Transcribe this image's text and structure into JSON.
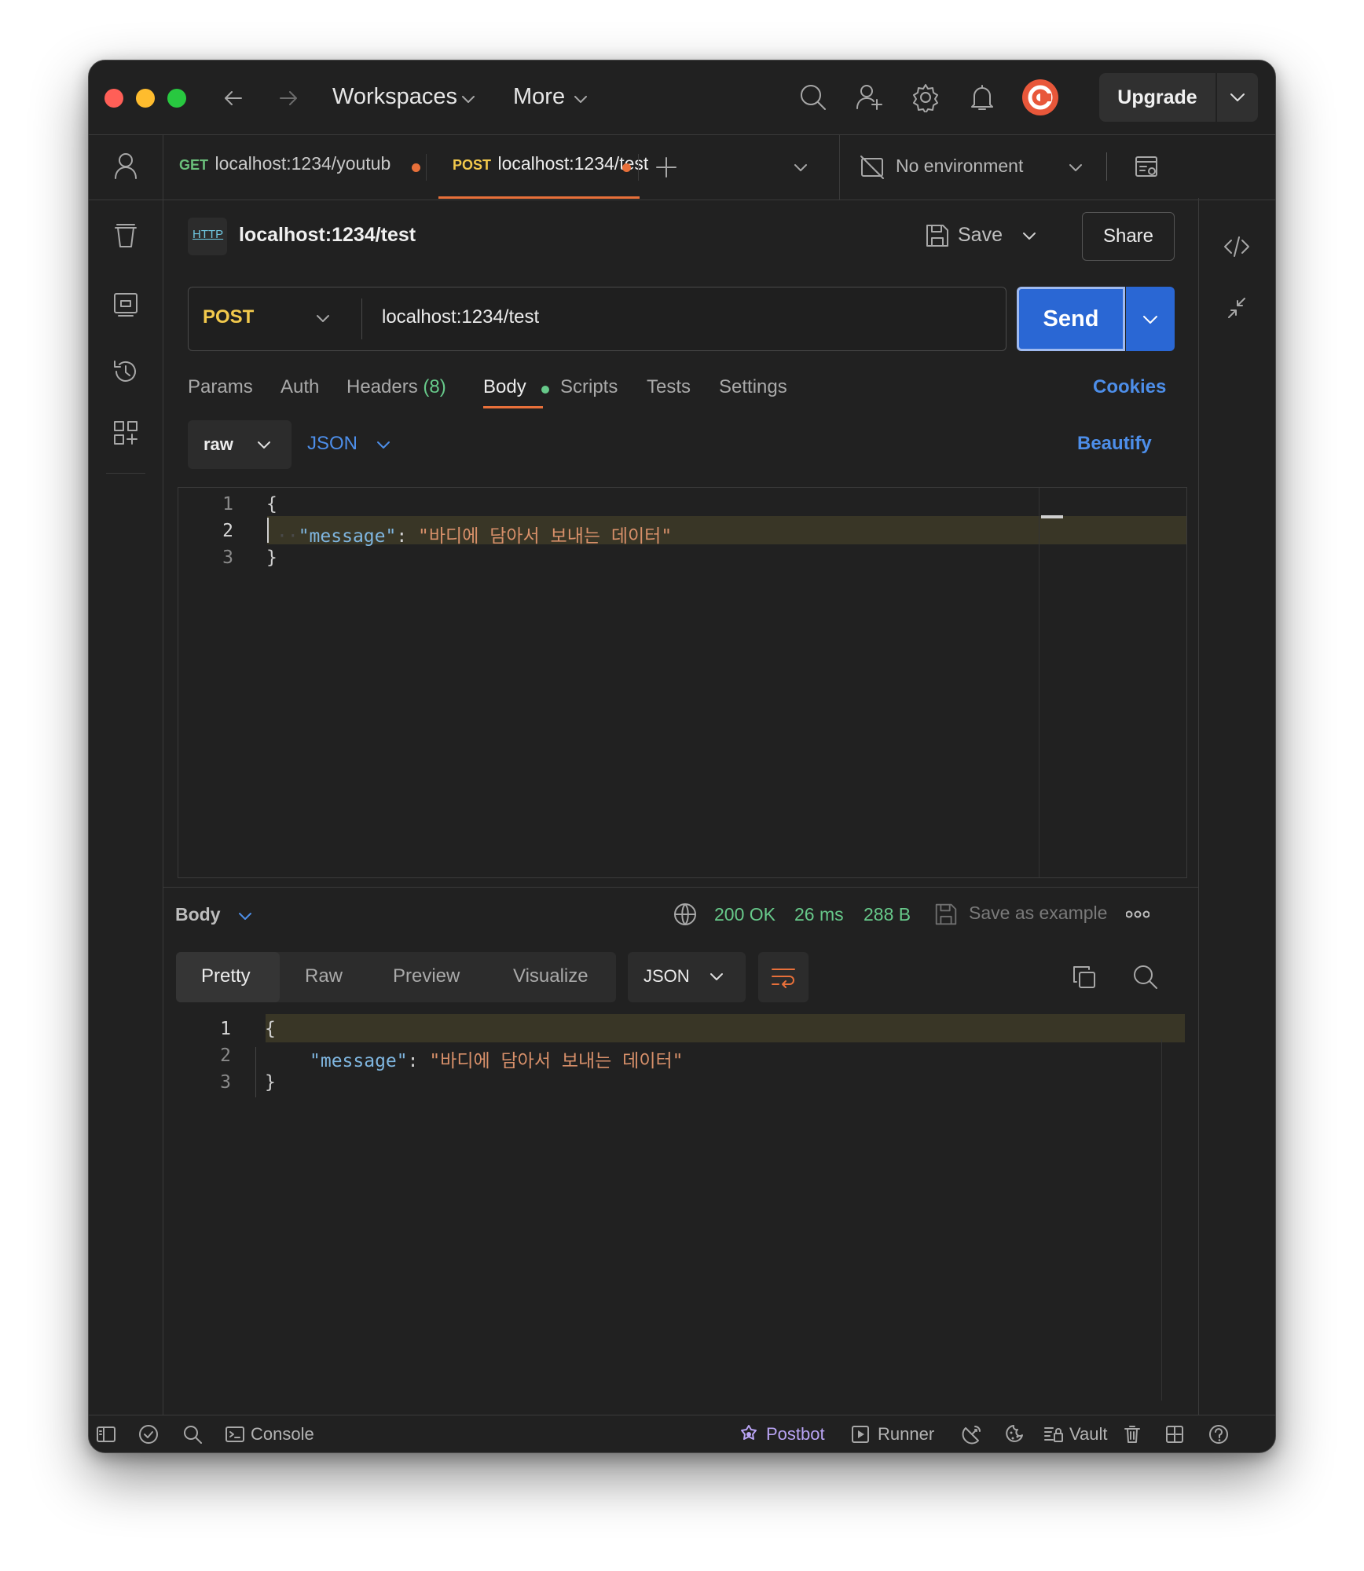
{
  "window": {
    "nav": {
      "workspaces_label": "Workspaces",
      "more_label": "More",
      "upgrade_label": "Upgrade"
    },
    "traffic_lights": {
      "close": "#ff5f57",
      "minimize": "#febc2e",
      "zoom": "#28c840"
    }
  },
  "tabs": [
    {
      "method": "GET",
      "url": "localhost:1234/youtub",
      "method_color": "#6bbf7b",
      "unsaved": true,
      "active": false
    },
    {
      "method": "POST",
      "url": "localhost:1234/test",
      "method_color": "#f2c94c",
      "unsaved": true,
      "active": true
    }
  ],
  "environment": {
    "label": "No environment"
  },
  "request": {
    "title": "localhost:1234/test",
    "http_badge": "HTTP",
    "save_label": "Save",
    "share_label": "Share",
    "method": "POST",
    "url": "localhost:1234/test",
    "send_label": "Send",
    "tabs": {
      "params": "Params",
      "auth": "Auth",
      "headers": "Headers",
      "headers_count": "(8)",
      "body": "Body",
      "scripts": "Scripts",
      "tests": "Tests",
      "settings": "Settings",
      "active": "Body"
    },
    "cookies_label": "Cookies",
    "body_mode": "raw",
    "body_language": "JSON",
    "beautify_label": "Beautify",
    "body_lines": {
      "line1": {
        "number": "1",
        "text": "{"
      },
      "line2": {
        "number": "2",
        "key": "\"message\"",
        "colon": ": ",
        "value": "\"바디에 담아서 보내는 데이터\""
      },
      "line3": {
        "number": "3",
        "text": "}"
      }
    }
  },
  "response": {
    "section_label": "Body",
    "status": "200 OK",
    "time": "26 ms",
    "size": "288 B",
    "save_example_label": "Save as example",
    "view_tabs": {
      "pretty": "Pretty",
      "raw": "Raw",
      "preview": "Preview",
      "visualize": "Visualize",
      "active": "Pretty"
    },
    "format": "JSON",
    "body_lines": {
      "line1": {
        "number": "1",
        "text": "{"
      },
      "line2": {
        "number": "2",
        "key": "\"message\"",
        "colon": ": ",
        "value": "\"바디에 담아서 보내는 데이터\""
      },
      "line3": {
        "number": "3",
        "text": "}"
      }
    }
  },
  "statusbar": {
    "console": "Console",
    "postbot": "Postbot",
    "runner": "Runner",
    "vault": "Vault"
  },
  "colors": {
    "accent_orange": "#e8703a",
    "send_blue": "#2a67d4",
    "link_blue": "#4d8ee9",
    "status_green": "#67c98a",
    "postbot_purple": "#b9a4f4",
    "background": "#212121"
  }
}
